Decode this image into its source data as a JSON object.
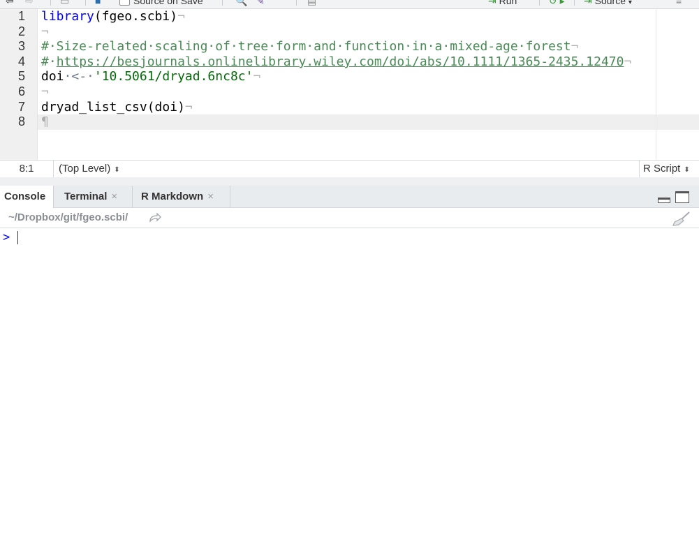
{
  "toolbar": {
    "source_on_save_label": "Source on Save",
    "run_label": "Run",
    "source_label": "Source"
  },
  "editor": {
    "line_numbers": [
      "1",
      "2",
      "3",
      "4",
      "5",
      "6",
      "7",
      "8"
    ],
    "lines": {
      "l1_fn": "library",
      "l1_arg": "(fgeo.scbi)",
      "l1_end": "¬",
      "l2_end": "¬",
      "l3_comment": "#·Size-related·scaling·of·tree·form·and·function·in·a·mixed-age·forest",
      "l3_end": "¬",
      "l4_hash": "#·",
      "l4_url": "https://besjournals.onlinelibrary.wiley.com/doi/abs/10.1111/1365-2435.12470",
      "l4_end": "¬",
      "l5_var": "doi",
      "l5_op": "·<-·",
      "l5_str": "'10.5061/dryad.6nc8c'",
      "l5_end": "¬",
      "l6_end": "¬",
      "l7_fn": "dryad_list_csv",
      "l7_arg": "(doi)",
      "l7_end": "¬",
      "l8_mark": "¶"
    }
  },
  "status": {
    "position": "8:1",
    "scope": "(Top Level)",
    "file_type": "R Script",
    "updown_glyph": "⬍"
  },
  "console_pane": {
    "tabs": [
      {
        "label": "Console"
      },
      {
        "label": "Terminal"
      },
      {
        "label": "R Markdown"
      }
    ],
    "close_glyph": "×",
    "working_dir": "~/Dropbox/git/fgeo.scbi/",
    "prompt": ">"
  }
}
